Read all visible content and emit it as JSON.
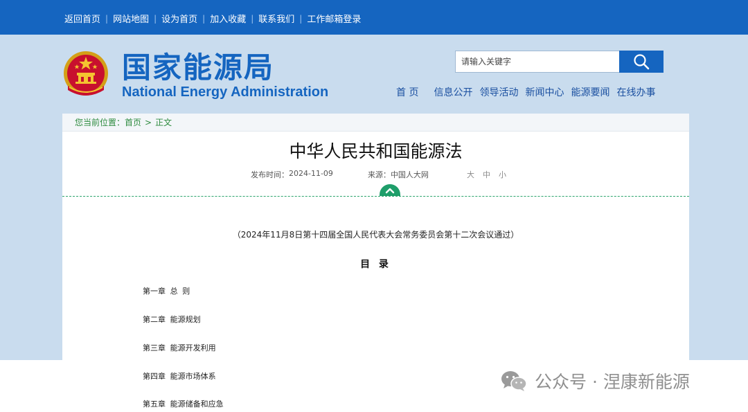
{
  "topbar": {
    "links": [
      "返回首页",
      "网站地图",
      "设为首页",
      "加入收藏",
      "联系我们",
      "工作邮箱登录"
    ],
    "separator": "|"
  },
  "header": {
    "logo_cn": "国家能源局",
    "logo_en": "National Energy Administration",
    "search_placeholder": "请输入关键字",
    "nav": [
      "首 页",
      "信息公开",
      "领导活动",
      "新闻中心",
      "能源要闻",
      "在线办事"
    ]
  },
  "breadcrumb": {
    "prefix": "您当前位置：",
    "home": "首页",
    "separator": ">",
    "current": "正文"
  },
  "article": {
    "title": "中华人民共和国能源法",
    "publish_label": "发布时间：",
    "publish_date": "2024-11-09",
    "source_label": "来源：",
    "source": "中国人大网",
    "font_sizes": [
      "大",
      "中",
      "小"
    ],
    "intro": "（2024年11月8日第十四届全国人民代表大会常务委员会第十二次会议通过）",
    "toc_title": "目 录",
    "toc": [
      "第一章  总  则",
      "第二章  能源规划",
      "第三章  能源开发利用",
      "第四章  能源市场体系",
      "第五章  能源储备和应急"
    ]
  },
  "watermark": "公众号 · 涅康新能源",
  "icons": {
    "emblem": "national-emblem-icon",
    "search": "search-icon",
    "toggle": "chevron-up-icon",
    "watermark": "wechat-icon"
  },
  "colors": {
    "brand_blue": "#1565c0",
    "header_bg": "#c9dcee",
    "breadcrumb_green": "#2e8b3f",
    "toggle_green": "#1e9e6a"
  }
}
